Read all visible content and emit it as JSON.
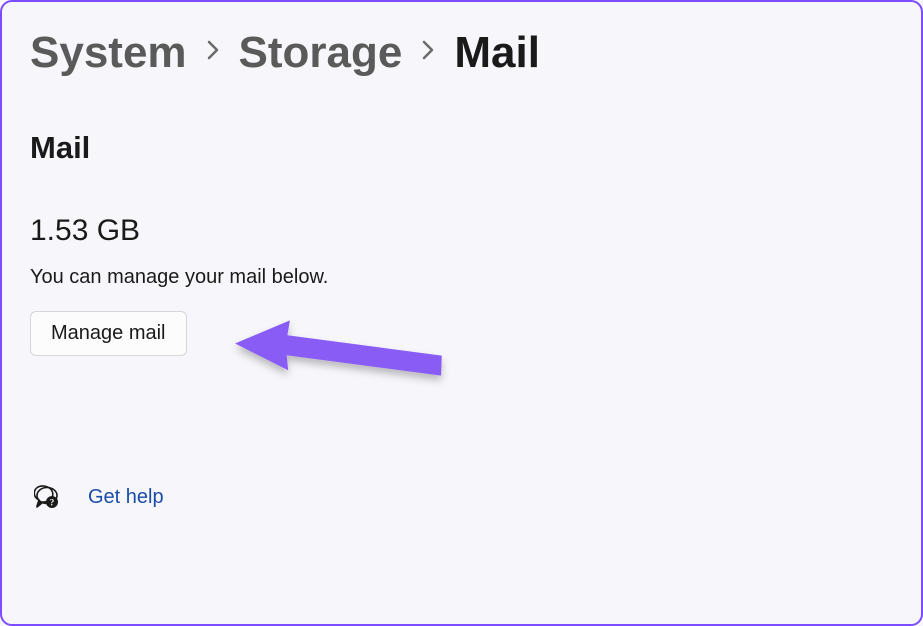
{
  "breadcrumb": {
    "items": [
      {
        "label": "System"
      },
      {
        "label": "Storage"
      },
      {
        "label": "Mail"
      }
    ]
  },
  "page": {
    "title": "Mail",
    "size": "1.53 GB",
    "description": "You can manage your mail below.",
    "manage_button_label": "Manage mail"
  },
  "help": {
    "label": "Get help"
  },
  "colors": {
    "accent": "#7c4dff",
    "link": "#1a4ca8",
    "text": "#1a1a1a",
    "muted": "#5a5a5a"
  }
}
